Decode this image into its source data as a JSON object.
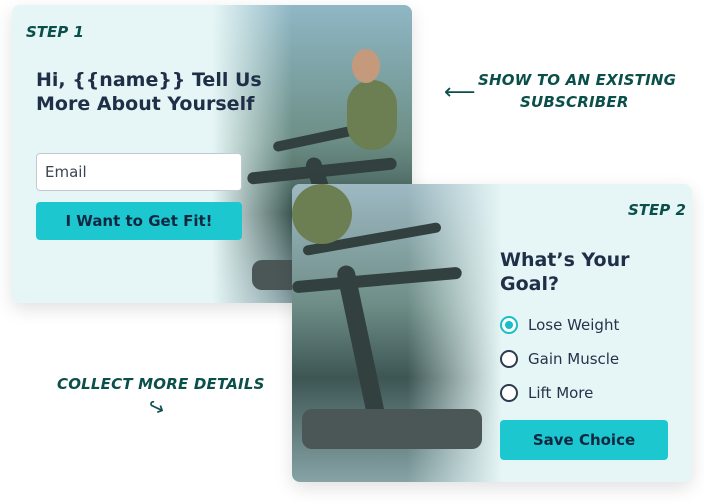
{
  "card1": {
    "step_label": "STEP 1",
    "title_line1": "Hi, {{name}} Tell Us",
    "title_line2": "More About Yourself",
    "email_placeholder": "Email",
    "cta_label": "I Want to Get Fit!"
  },
  "card2": {
    "step_label": "STEP 2",
    "title_line1": "What’s Your",
    "title_line2": "Goal?",
    "options": [
      {
        "label": "Lose Weight",
        "selected": true
      },
      {
        "label": "Gain Muscle",
        "selected": false
      },
      {
        "label": "Lift More",
        "selected": false
      }
    ],
    "cta_label": "Save Choice"
  },
  "annotations": {
    "existing_line1": "SHOW TO AN EXISTING",
    "existing_line2": "SUBSCRIBER",
    "collect": "COLLECT MORE DETAILS"
  },
  "icons": {
    "arrow_left": "arrow-left-icon",
    "arrow_curved": "curved-arrow-icon"
  },
  "colors": {
    "card_bg": "#e6f6f6",
    "accent": "#1cc7cf",
    "title": "#1f2f48",
    "annotation": "#0b4f4a"
  }
}
